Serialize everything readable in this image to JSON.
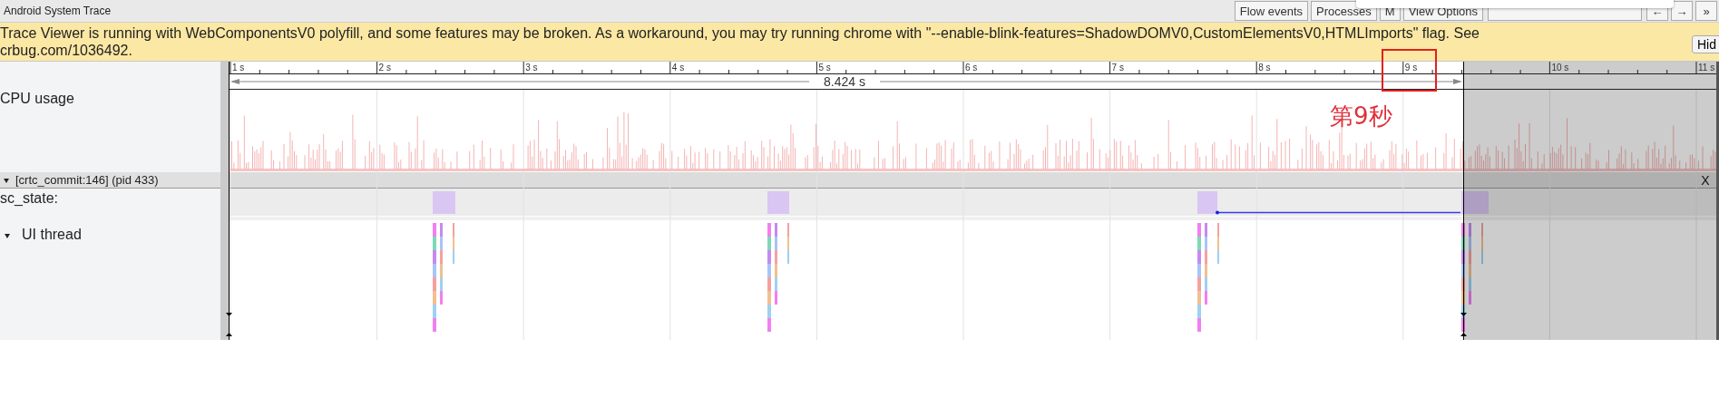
{
  "window": {
    "title": "Android System Trace"
  },
  "toolbar": {
    "buttons": [
      {
        "label": "Flow events"
      },
      {
        "label": "Processes"
      },
      {
        "label": "M"
      },
      {
        "label": "View Options"
      }
    ],
    "nav_buttons": [
      "←",
      "→",
      "»"
    ]
  },
  "banner": {
    "message": "Trace Viewer is running with WebComponentsV0 polyfill, and some features may be broken. As a workaround, you may try running chrome with \"--enable-blink-features=ShadowDOMV0,CustomElementsV0,HTMLImports\" flag. See crbug.com/1036492.",
    "hide_button": "Hid"
  },
  "ruler": {
    "ticks": [
      "1 s",
      "2 s",
      "3 s",
      "4 s",
      "5 s",
      "6 s",
      "7 s",
      "8 s",
      "9 s",
      "10 s",
      "11 s"
    ],
    "selection_duration": "8.424 s"
  },
  "tracks": [
    {
      "kind": "cpu",
      "label": "CPU usage"
    },
    {
      "kind": "process",
      "label": "[crtc_commit:146] (pid 433)",
      "expanded": true,
      "close": "X"
    },
    {
      "kind": "counter",
      "label": "sc_state:"
    },
    {
      "kind": "thread",
      "label": "UI thread",
      "expanded": true
    }
  ],
  "annotation": {
    "text": "第9秒"
  }
}
